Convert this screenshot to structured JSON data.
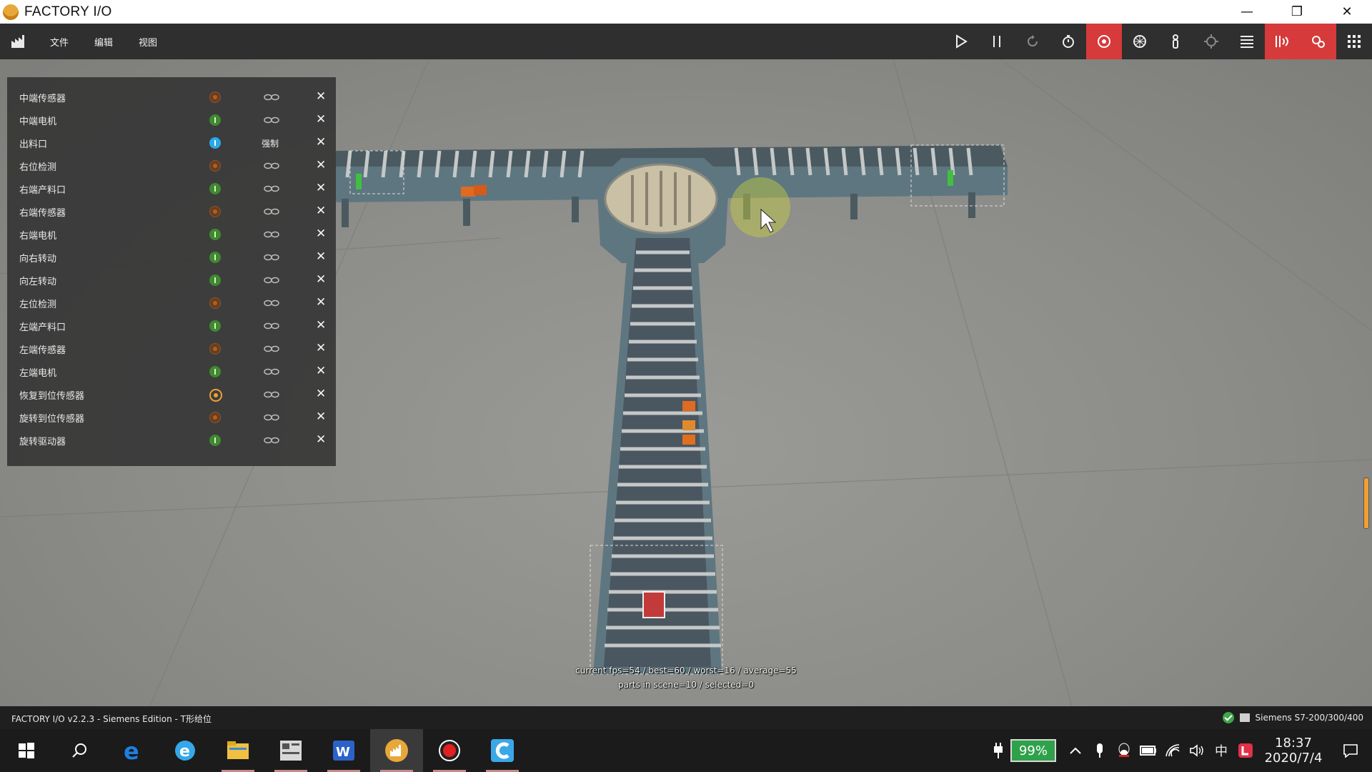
{
  "window": {
    "title": "FACTORY I/O",
    "minimize": "—",
    "restore": "❐",
    "close": "✕"
  },
  "menu": {
    "items": [
      "文件",
      "编辑",
      "视图"
    ]
  },
  "toolbar": {
    "icons": [
      "play-icon",
      "pause-icon",
      "reset-icon",
      "timer-icon",
      "sensor-view-icon",
      "camera-orbit-icon",
      "first-person-icon",
      "target-icon",
      "list-icon",
      "drivers-icon",
      "settings-icon",
      "grid-icon"
    ],
    "active_color": "#d63a3a"
  },
  "tags": [
    {
      "label": "中端传感器",
      "state": "off",
      "action": "link"
    },
    {
      "label": "中端电机",
      "state": "on",
      "action": "link"
    },
    {
      "label": "出料口",
      "state": "force",
      "action": "强制"
    },
    {
      "label": "右位检测",
      "state": "off",
      "action": "link"
    },
    {
      "label": "右端产料口",
      "state": "on",
      "action": "link"
    },
    {
      "label": "右端传感器",
      "state": "off",
      "action": "link"
    },
    {
      "label": "右端电机",
      "state": "on",
      "action": "link"
    },
    {
      "label": "向右转动",
      "state": "on",
      "action": "link"
    },
    {
      "label": "向左转动",
      "state": "on",
      "action": "link"
    },
    {
      "label": "左位检测",
      "state": "off",
      "action": "link"
    },
    {
      "label": "左端产料口",
      "state": "on",
      "action": "link"
    },
    {
      "label": "左端传感器",
      "state": "off",
      "action": "link"
    },
    {
      "label": "左端电机",
      "state": "on",
      "action": "link"
    },
    {
      "label": "恢复到位传感器",
      "state": "ring",
      "action": "link"
    },
    {
      "label": "旋转到位传感器",
      "state": "off",
      "action": "link"
    },
    {
      "label": "旋转驱动器",
      "state": "on",
      "action": "link"
    }
  ],
  "scene": {
    "fps_line": "current fps=54 / best=60 / worst=16 / average=55",
    "parts_line": "parts in scene=10 / selected=0"
  },
  "statusbar": {
    "left": "FACTORY I/O v2.2.3 - Siemens Edition - T形给位",
    "driver": "Siemens S7-200/300/400"
  },
  "taskbar": {
    "apps": [
      "start-icon",
      "search-icon",
      "edge-icon",
      "ie-icon",
      "file-explorer-icon",
      "plc-editor-icon",
      "wps-icon",
      "factory-io-icon",
      "record-icon",
      "browser-icon"
    ],
    "battery": "99%",
    "ime": "中",
    "time": "18:37",
    "date": "2020/7/4"
  }
}
